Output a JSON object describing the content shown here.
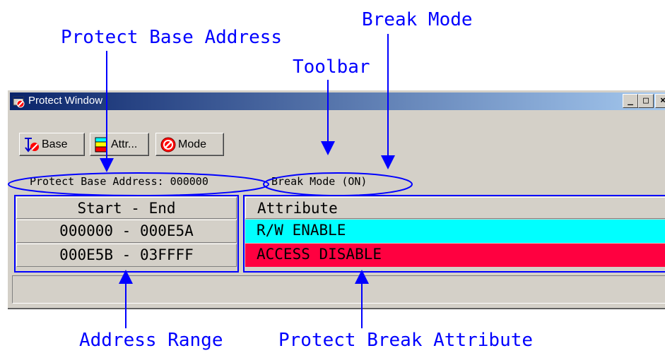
{
  "annotations": {
    "protect_base_address": "Protect Base Address",
    "break_mode": "Break Mode",
    "toolbar": "Toolbar",
    "address_range": "Address Range",
    "protect_break_attribute": "Protect Break Attribute",
    "color": "#0000ff"
  },
  "window": {
    "title": "Protect Window",
    "minimize": "_",
    "maximize": "□",
    "close": "×"
  },
  "toolbar": {
    "base_label": "Base",
    "attr_label": "Attr...",
    "mode_label": "Mode"
  },
  "status": {
    "base_address": "Protect Base Address: 000000",
    "break_mode": "Break Mode (ON)"
  },
  "range_table": {
    "header": "Start - End",
    "rows": [
      "000000 - 000E5A",
      "000E5B - 03FFFF"
    ]
  },
  "attribute_table": {
    "header": "Attribute",
    "rows": [
      {
        "value": "R/W ENABLE",
        "color": "#00ffff"
      },
      {
        "value": "ACCESS DISABLE",
        "color": "#ff0040"
      }
    ]
  }
}
